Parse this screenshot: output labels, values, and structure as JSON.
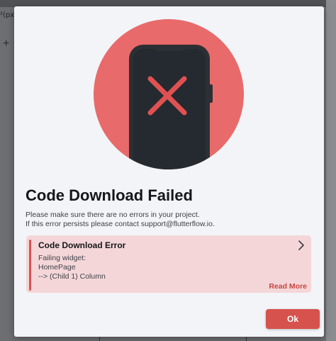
{
  "background": {
    "label_fragment": "²(px)",
    "plus_icon": "+"
  },
  "dialog": {
    "illustration": "phone-error-icon",
    "title": "Code Download Failed",
    "message_line1": "Please make sure there are no errors in your project.",
    "message_line2": "If this error persists please contact support@flutterflow.io.",
    "error_card": {
      "title": "Code Download Error",
      "line1": "Failing widget:",
      "line2": "HomePage",
      "line3": "--> (Child 1) Column",
      "read_more": "Read More",
      "expand_icon": "chevron-right-icon"
    },
    "ok_label": "Ok"
  },
  "colors": {
    "accent": "#d6524c",
    "hero": "#e86a6a",
    "error_bg": "#f4d6d9",
    "phone": "#2c3034"
  }
}
